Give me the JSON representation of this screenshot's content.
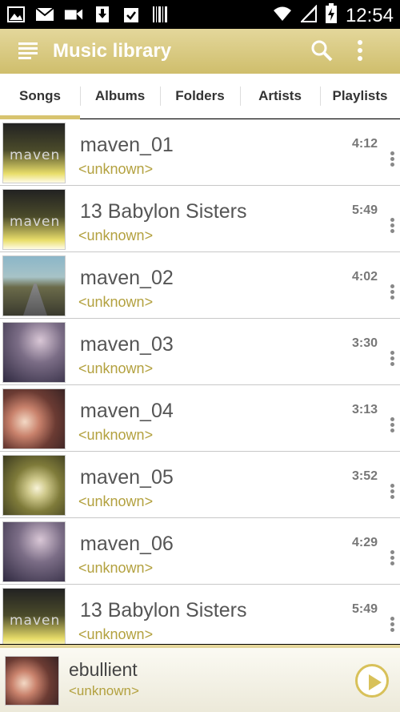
{
  "statusbar": {
    "time": "12:54",
    "left_icons": [
      "image-icon",
      "gmail-icon",
      "video-icon",
      "download-icon",
      "clipboard-check-icon",
      "barcode-icon"
    ],
    "right_icons": [
      "wifi-icon",
      "signal-icon",
      "battery-charging-icon"
    ]
  },
  "actionbar": {
    "title": "Music library",
    "icons": [
      "menu-icon",
      "search-icon",
      "more-vert-icon"
    ]
  },
  "tabs": [
    {
      "label": "Songs",
      "active": true
    },
    {
      "label": "Albums",
      "active": false
    },
    {
      "label": "Folders",
      "active": false
    },
    {
      "label": "Artists",
      "active": false
    },
    {
      "label": "Playlists",
      "active": false
    }
  ],
  "songs": [
    {
      "title": "maven_01",
      "artist": "<unknown>",
      "duration": "4:12",
      "art": "maven"
    },
    {
      "title": "13 Babylon Sisters",
      "artist": "<unknown>",
      "duration": "5:49",
      "art": "maven"
    },
    {
      "title": "maven_02",
      "artist": "<unknown>",
      "duration": "4:02",
      "art": "road"
    },
    {
      "title": "maven_03",
      "artist": "<unknown>",
      "duration": "3:30",
      "art": "blur"
    },
    {
      "title": "maven_04",
      "artist": "<unknown>",
      "duration": "3:13",
      "art": "rose"
    },
    {
      "title": "maven_05",
      "artist": "<unknown>",
      "duration": "3:52",
      "art": "dandelion"
    },
    {
      "title": "maven_06",
      "artist": "<unknown>",
      "duration": "4:29",
      "art": "blur"
    },
    {
      "title": "13 Babylon Sisters",
      "artist": "<unknown>",
      "duration": "5:49",
      "art": "maven"
    }
  ],
  "album_art_text": "maven",
  "now_playing": {
    "title": "ebullient",
    "artist": "<unknown>",
    "art": "rose"
  },
  "colors": {
    "accent": "#d8c46f",
    "artist_text": "#b3a13f"
  }
}
